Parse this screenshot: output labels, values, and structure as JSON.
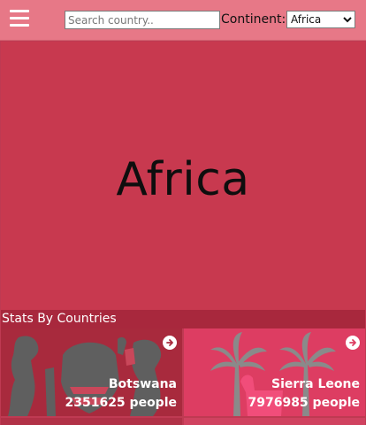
{
  "header": {
    "menu_icon": "hamburger-menu-icon",
    "search_placeholder": "Search country..",
    "continent_label": "Continent:",
    "continent_selected": "Africa",
    "continent_options": [
      "Africa"
    ]
  },
  "hero": {
    "title": "Africa"
  },
  "stats": {
    "heading": "Stats By Countries",
    "countries": [
      {
        "name": "Botswana",
        "population": "2351625 people",
        "icon": "arrow-right-circle-icon"
      },
      {
        "name": "Sierra Leone",
        "population": "7976985 people",
        "icon": "arrow-right-circle-icon"
      }
    ]
  },
  "colors": {
    "header_bg": "#e77887",
    "hero_bg": "#c8394f",
    "stats_bar_bg": "#a8283d",
    "card_botswana_bg": "#a82a3d",
    "card_sierra_bg": "#dd3d62"
  }
}
